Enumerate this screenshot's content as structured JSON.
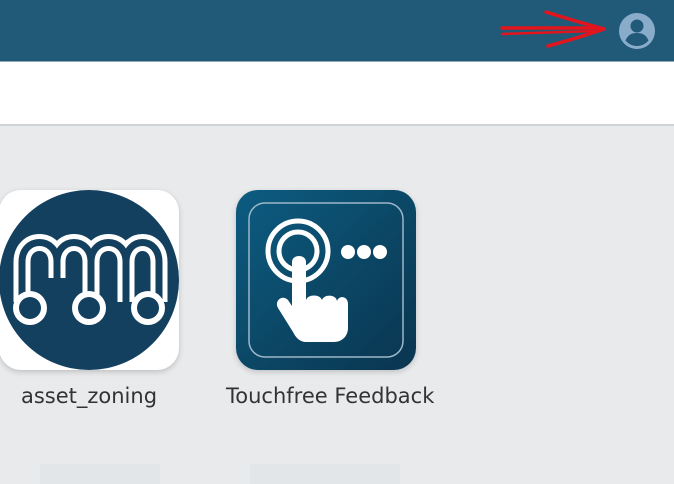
{
  "header": {
    "account_icon": "account-circle-icon",
    "annotation": "red-arrow-pointing-right"
  },
  "apps": [
    {
      "label": "asset_zoning",
      "icon": "m-logo-icon"
    },
    {
      "label": "Touchfree Feedback",
      "icon": "touch-tap-icon"
    }
  ],
  "colors": {
    "header_bg": "#215a78",
    "toolbar_bg": "#ffffff",
    "content_bg": "#e8eaec",
    "account_icon": "#8aaccb",
    "arrow": "#e3141b",
    "label_text": "#333333"
  }
}
